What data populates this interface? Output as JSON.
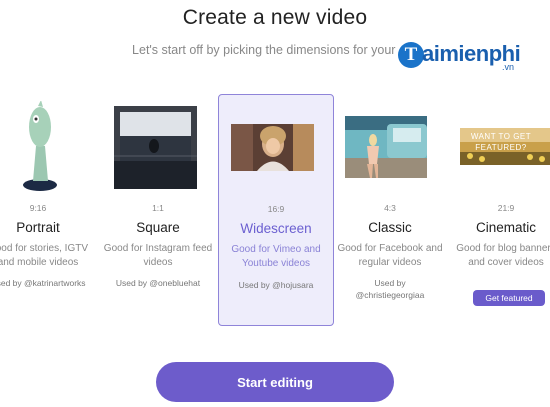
{
  "header": {
    "title": "Create a new video",
    "subtitle": "Let's start off by picking the dimensions for your vi"
  },
  "watermark": {
    "badge": "T",
    "text": "aimienphi",
    "sub": ".vn"
  },
  "cards": [
    {
      "ratio": "9:16",
      "name": "Portrait",
      "desc": "Good for stories, IGTV and mobile videos",
      "credit": "Used by @katrinartworks"
    },
    {
      "ratio": "1:1",
      "name": "Square",
      "desc": "Good for Instagram feed videos",
      "credit": "Used by @onebluehat"
    },
    {
      "ratio": "16:9",
      "name": "Widescreen",
      "desc": "Good for Vimeo and Youtube videos",
      "credit": "Used by @hojusara"
    },
    {
      "ratio": "4:3",
      "name": "Classic",
      "desc": "Good for Facebook and regular videos",
      "credit": "Used by @christiegeorgiaa"
    },
    {
      "ratio": "21:9",
      "name": "Cinematic",
      "desc": "Good for blog banners and cover videos",
      "button": "Get featured",
      "thumb_text": "WANT TO GET FEATURED?"
    }
  ],
  "start_button": "Start editing"
}
